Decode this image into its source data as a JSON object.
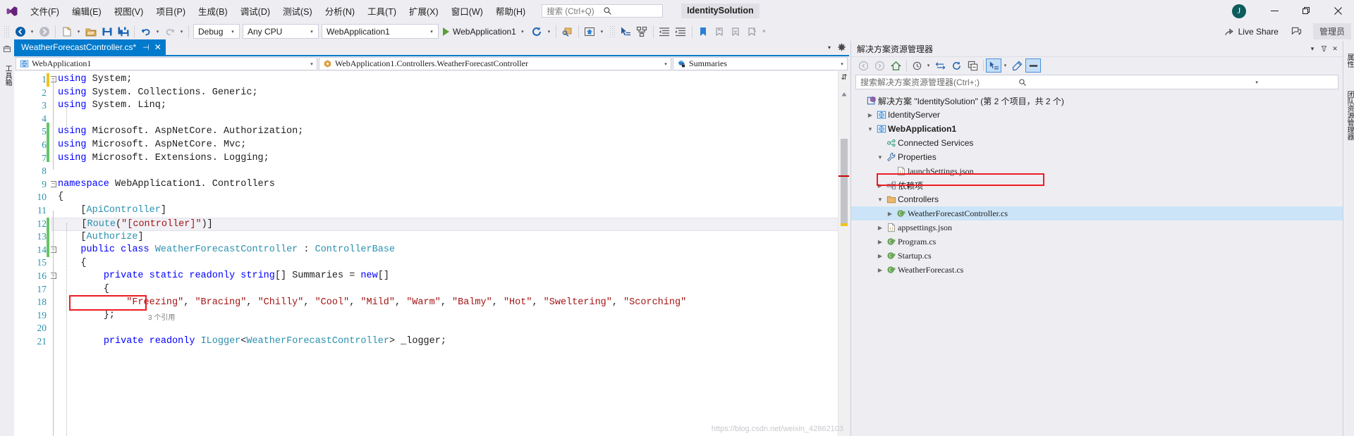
{
  "window": {
    "solution_title": "IdentitySolution",
    "account_initial": "J",
    "minimize": "—",
    "restore": "❐",
    "close": "✕"
  },
  "menu": {
    "items": [
      {
        "label": "文件(F)",
        "name": "menu-file"
      },
      {
        "label": "编辑(E)",
        "name": "menu-edit"
      },
      {
        "label": "视图(V)",
        "name": "menu-view"
      },
      {
        "label": "项目(P)",
        "name": "menu-project"
      },
      {
        "label": "生成(B)",
        "name": "menu-build"
      },
      {
        "label": "调试(D)",
        "name": "menu-debug"
      },
      {
        "label": "测试(S)",
        "name": "menu-test"
      },
      {
        "label": "分析(N)",
        "name": "menu-analyze"
      },
      {
        "label": "工具(T)",
        "name": "menu-tools"
      },
      {
        "label": "扩展(X)",
        "name": "menu-extensions"
      },
      {
        "label": "窗口(W)",
        "name": "menu-window"
      },
      {
        "label": "帮助(H)",
        "name": "menu-help"
      }
    ]
  },
  "quick_launch": {
    "placeholder": "搜索 (Ctrl+Q)",
    "value": ""
  },
  "toolbar": {
    "config": "Debug",
    "platform": "Any CPU",
    "startup_project": "WebApplication1",
    "run_target": "WebApplication1",
    "live_share": "Live Share",
    "admin_badge": "管理员"
  },
  "left_rail": {
    "toolbox_label": "工具箱"
  },
  "document": {
    "tab_label": "WeatherForecastController.cs*",
    "pin_glyph": "⊣",
    "close_glyph": "✕",
    "nav": {
      "project": "WebApplication1",
      "type": "WebApplication1.Controllers.WeatherForecastController",
      "member": "Summaries"
    },
    "reference_hint": "3 个引用",
    "watermark": "https://blog.csdn.net/weixin_42862103"
  },
  "code": {
    "line_numbers": [
      1,
      2,
      3,
      4,
      5,
      6,
      7,
      8,
      9,
      10,
      11,
      12,
      13,
      14,
      15,
      16,
      17,
      18,
      19,
      20,
      21
    ],
    "lines": [
      {
        "n": 1,
        "tokens": [
          {
            "t": "using",
            "c": "k"
          },
          {
            "t": " System;",
            "c": "p"
          }
        ],
        "fold": "minus"
      },
      {
        "n": 2,
        "tokens": [
          {
            "t": "using",
            "c": "k"
          },
          {
            "t": " System. Collections. Generic;",
            "c": "p"
          }
        ]
      },
      {
        "n": 3,
        "tokens": [
          {
            "t": "using",
            "c": "k"
          },
          {
            "t": " System. Linq;",
            "c": "p"
          }
        ]
      },
      {
        "n": 4,
        "tokens": []
      },
      {
        "n": 5,
        "tokens": [
          {
            "t": "using",
            "c": "k"
          },
          {
            "t": " Microsoft. AspNetCore. Authorization;",
            "c": "p"
          }
        ]
      },
      {
        "n": 6,
        "tokens": [
          {
            "t": "using",
            "c": "k"
          },
          {
            "t": " Microsoft. AspNetCore. Mvc;",
            "c": "p"
          }
        ]
      },
      {
        "n": 7,
        "tokens": [
          {
            "t": "using",
            "c": "k"
          },
          {
            "t": " Microsoft. Extensions. Logging;",
            "c": "p"
          }
        ]
      },
      {
        "n": 8,
        "tokens": []
      },
      {
        "n": 9,
        "tokens": [
          {
            "t": "namespace",
            "c": "k"
          },
          {
            "t": " WebApplication1. Controllers",
            "c": "p"
          }
        ],
        "fold": "minus"
      },
      {
        "n": 10,
        "tokens": [
          {
            "t": "{",
            "c": "p"
          }
        ]
      },
      {
        "n": 11,
        "tokens": [
          {
            "t": "    [",
            "c": "p"
          },
          {
            "t": "ApiController",
            "c": "t"
          },
          {
            "t": "]",
            "c": "p"
          }
        ]
      },
      {
        "n": 12,
        "tokens": [
          {
            "t": "    [",
            "c": "p"
          },
          {
            "t": "Route",
            "c": "t"
          },
          {
            "t": "(",
            "c": "p"
          },
          {
            "t": "\"[controller]\"",
            "c": "s"
          },
          {
            "t": ")",
            "c": "p"
          },
          {
            "t": "]",
            "c": "p"
          }
        ],
        "highlight": true
      },
      {
        "n": 13,
        "tokens": [
          {
            "t": "    [",
            "c": "p"
          },
          {
            "t": "Authorize",
            "c": "t"
          },
          {
            "t": "]",
            "c": "p"
          }
        ]
      },
      {
        "n": 14,
        "tokens": [
          {
            "t": "    ",
            "c": "p"
          },
          {
            "t": "public",
            "c": "k"
          },
          {
            "t": " ",
            "c": "p"
          },
          {
            "t": "class",
            "c": "k"
          },
          {
            "t": " ",
            "c": "p"
          },
          {
            "t": "WeatherForecastController",
            "c": "t"
          },
          {
            "t": " : ",
            "c": "p"
          },
          {
            "t": "ControllerBase",
            "c": "t"
          }
        ],
        "fold": "minus"
      },
      {
        "n": 15,
        "tokens": [
          {
            "t": "    {",
            "c": "p"
          }
        ]
      },
      {
        "n": 16,
        "tokens": [
          {
            "t": "        ",
            "c": "p"
          },
          {
            "t": "private",
            "c": "k"
          },
          {
            "t": " ",
            "c": "p"
          },
          {
            "t": "static",
            "c": "k"
          },
          {
            "t": " ",
            "c": "p"
          },
          {
            "t": "readonly",
            "c": "k"
          },
          {
            "t": " ",
            "c": "p"
          },
          {
            "t": "string",
            "c": "k"
          },
          {
            "t": "[] Summaries = ",
            "c": "p"
          },
          {
            "t": "new",
            "c": "k"
          },
          {
            "t": "[]",
            "c": "p"
          }
        ],
        "fold": "minus"
      },
      {
        "n": 17,
        "tokens": [
          {
            "t": "        {",
            "c": "p"
          }
        ]
      },
      {
        "n": 18,
        "tokens": [
          {
            "t": "            ",
            "c": "p"
          },
          {
            "t": "\"Freezing\"",
            "c": "s"
          },
          {
            "t": ", ",
            "c": "p"
          },
          {
            "t": "\"Bracing\"",
            "c": "s"
          },
          {
            "t": ", ",
            "c": "p"
          },
          {
            "t": "\"Chilly\"",
            "c": "s"
          },
          {
            "t": ", ",
            "c": "p"
          },
          {
            "t": "\"Cool\"",
            "c": "s"
          },
          {
            "t": ", ",
            "c": "p"
          },
          {
            "t": "\"Mild\"",
            "c": "s"
          },
          {
            "t": ", ",
            "c": "p"
          },
          {
            "t": "\"Warm\"",
            "c": "s"
          },
          {
            "t": ", ",
            "c": "p"
          },
          {
            "t": "\"Balmy\"",
            "c": "s"
          },
          {
            "t": ", ",
            "c": "p"
          },
          {
            "t": "\"Hot\"",
            "c": "s"
          },
          {
            "t": ", ",
            "c": "p"
          },
          {
            "t": "\"Sweltering\"",
            "c": "s"
          },
          {
            "t": ", ",
            "c": "p"
          },
          {
            "t": "\"Scorching\"",
            "c": "s"
          }
        ]
      },
      {
        "n": 19,
        "tokens": [
          {
            "t": "        };",
            "c": "p"
          }
        ]
      },
      {
        "n": 20,
        "tokens": []
      },
      {
        "n": 21,
        "tokens": [
          {
            "t": "        ",
            "c": "p"
          },
          {
            "t": "private",
            "c": "k"
          },
          {
            "t": " ",
            "c": "p"
          },
          {
            "t": "readonly",
            "c": "k"
          },
          {
            "t": " ",
            "c": "p"
          },
          {
            "t": "ILogger",
            "c": "t"
          },
          {
            "t": "<",
            "c": "p"
          },
          {
            "t": "WeatherForecastController",
            "c": "t"
          },
          {
            "t": "> _logger;",
            "c": "p"
          }
        ]
      }
    ]
  },
  "solution_explorer": {
    "title": "解决方案资源管理器",
    "search_placeholder": "搜索解决方案资源管理器(Ctrl+;)",
    "tree": [
      {
        "depth": 0,
        "label": "解决方案 \"IdentitySolution\" (第 2 个项目，共 2 个)",
        "icon": "solution-icon",
        "expander": "",
        "bold": false,
        "selected": false
      },
      {
        "depth": 1,
        "label": "IdentityServer",
        "icon": "project-web-icon",
        "expander": "collapsed",
        "bold": false,
        "selected": false
      },
      {
        "depth": 1,
        "label": "WebApplication1",
        "icon": "project-web-icon",
        "expander": "expanded",
        "bold": true,
        "selected": false
      },
      {
        "depth": 2,
        "label": "Connected Services",
        "icon": "connected-services-icon",
        "expander": "",
        "bold": false,
        "selected": false
      },
      {
        "depth": 2,
        "label": "Properties",
        "icon": "wrench-icon",
        "expander": "expanded",
        "bold": false,
        "selected": false
      },
      {
        "depth": 3,
        "label": "launchSettings.json",
        "icon": "json-icon",
        "expander": "",
        "bold": false,
        "selected": false
      },
      {
        "depth": 2,
        "label": "依赖项",
        "icon": "dependencies-icon",
        "expander": "collapsed",
        "bold": false,
        "selected": false
      },
      {
        "depth": 2,
        "label": "Controllers",
        "icon": "folder-icon",
        "expander": "expanded",
        "bold": false,
        "selected": false
      },
      {
        "depth": 3,
        "label": "WeatherForecastController.cs",
        "icon": "csharp-icon",
        "expander": "collapsed",
        "bold": false,
        "selected": true
      },
      {
        "depth": 2,
        "label": "appsettings.json",
        "icon": "json-icon",
        "expander": "collapsed",
        "bold": false,
        "selected": false
      },
      {
        "depth": 2,
        "label": "Program.cs",
        "icon": "csharp-icon",
        "expander": "collapsed",
        "bold": false,
        "selected": false
      },
      {
        "depth": 2,
        "label": "Startup.cs",
        "icon": "csharp-icon",
        "expander": "collapsed",
        "bold": false,
        "selected": false
      },
      {
        "depth": 2,
        "label": "WeatherForecast.cs",
        "icon": "csharp-icon",
        "expander": "collapsed",
        "bold": false,
        "selected": false
      }
    ]
  },
  "right_rail": {
    "tabs": [
      "属性",
      "团队资源管理器"
    ]
  },
  "colors": {
    "accent": "#007acc",
    "chrome": "#eeeef2",
    "keyword": "#0000ff",
    "type": "#2b91af",
    "string": "#a31515",
    "highlight_box": "#ed1c24",
    "selection_row": "#cbe4f7"
  }
}
